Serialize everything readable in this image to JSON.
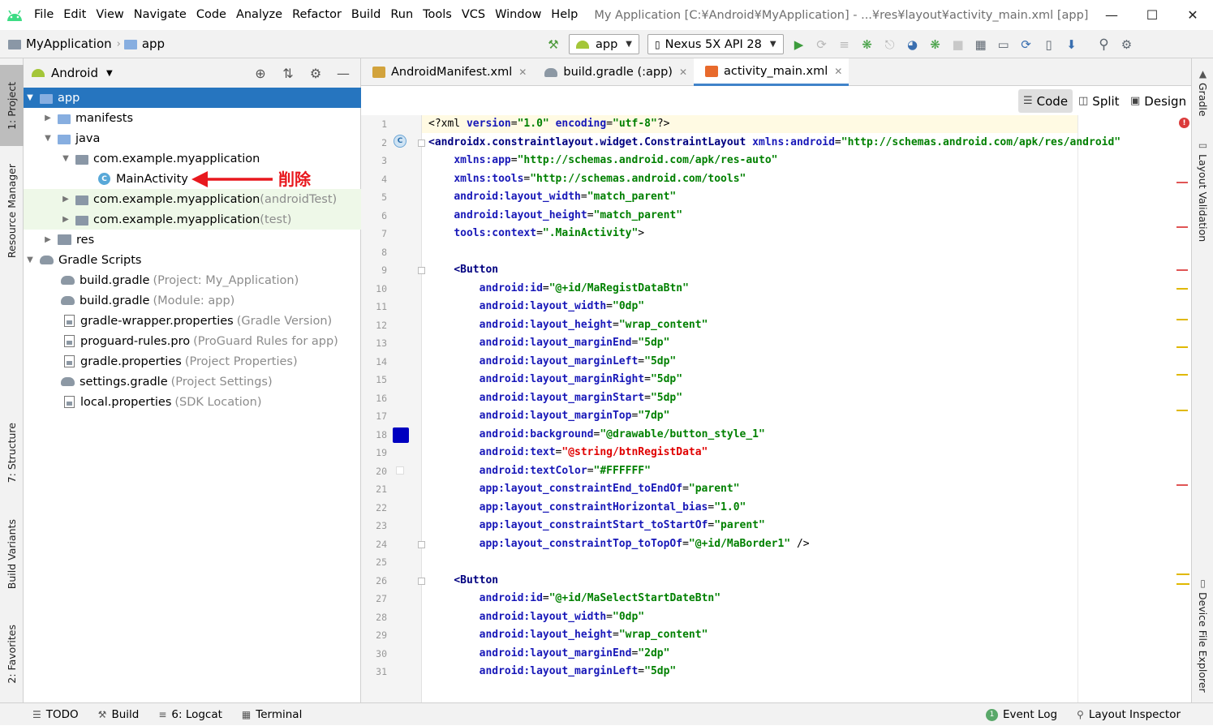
{
  "menubar": {
    "items": [
      "File",
      "Edit",
      "View",
      "Navigate",
      "Code",
      "Analyze",
      "Refactor",
      "Build",
      "Run",
      "Tools",
      "VCS",
      "Window",
      "Help"
    ],
    "window_title": "My Application [C:¥Android¥MyApplication] - ...¥res¥layout¥activity_main.xml [app]"
  },
  "navbar": {
    "project": "MyApplication",
    "module": "app",
    "run_config": "app",
    "device": "Nexus 5X API 28"
  },
  "left_tabs": [
    "1: Project",
    "Resource Manager",
    "7: Structure",
    "Build Variants",
    "2: Favorites"
  ],
  "right_tabs": [
    "Gradle",
    "Layout Validation",
    "Device File Explorer"
  ],
  "project_panel": {
    "view": "Android",
    "tree": [
      {
        "label": "app",
        "secondary": ""
      },
      {
        "label": "manifests",
        "secondary": ""
      },
      {
        "label": "java",
        "secondary": ""
      },
      {
        "label": "com.example.myapplication",
        "secondary": ""
      },
      {
        "label": "MainActivity",
        "secondary": ""
      },
      {
        "label": "com.example.myapplication",
        "secondary": "(androidTest)"
      },
      {
        "label": "com.example.myapplication",
        "secondary": "(test)"
      },
      {
        "label": "res",
        "secondary": ""
      },
      {
        "label": "Gradle Scripts",
        "secondary": ""
      },
      {
        "label": "build.gradle",
        "secondary": "(Project: My_Application)"
      },
      {
        "label": "build.gradle",
        "secondary": "(Module: app)"
      },
      {
        "label": "gradle-wrapper.properties",
        "secondary": "(Gradle Version)"
      },
      {
        "label": "proguard-rules.pro",
        "secondary": "(ProGuard Rules for app)"
      },
      {
        "label": "gradle.properties",
        "secondary": "(Project Properties)"
      },
      {
        "label": "settings.gradle",
        "secondary": "(Project Settings)"
      },
      {
        "label": "local.properties",
        "secondary": "(SDK Location)"
      }
    ]
  },
  "annotation": {
    "text": "削除",
    "color": "#e8181e"
  },
  "editor_tabs": [
    "AndroidManifest.xml",
    "build.gradle (:app)",
    "activity_main.xml"
  ],
  "editor_modes": [
    "Code",
    "Split",
    "Design"
  ],
  "code_lines": [
    "<?xml version=\"1.0\" encoding=\"utf-8\"?>",
    "<androidx.constraintlayout.widget.ConstraintLayout xmlns:android=\"http://schemas.android.com/apk/res/android\"",
    "    xmlns:app=\"http://schemas.android.com/apk/res-auto\"",
    "    xmlns:tools=\"http://schemas.android.com/tools\"",
    "    android:layout_width=\"match_parent\"",
    "    android:layout_height=\"match_parent\"",
    "    tools:context=\".MainActivity\">",
    "",
    "    <Button",
    "        android:id=\"@+id/MaRegistDataBtn\"",
    "        android:layout_width=\"0dp\"",
    "        android:layout_height=\"wrap_content\"",
    "        android:layout_marginEnd=\"5dp\"",
    "        android:layout_marginLeft=\"5dp\"",
    "        android:layout_marginRight=\"5dp\"",
    "        android:layout_marginStart=\"5dp\"",
    "        android:layout_marginTop=\"7dp\"",
    "        android:background=\"@drawable/button_style_1\"",
    "        android:text=\"@string/btnRegistData\"",
    "        android:textColor=\"#FFFFFF\"",
    "        app:layout_constraintEnd_toEndOf=\"parent\"",
    "        app:layout_constraintHorizontal_bias=\"1.0\"",
    "        app:layout_constraintStart_toStartOf=\"parent\"",
    "        app:layout_constraintTop_toTopOf=\"@+id/MaBorder1\" />",
    "",
    "    <Button",
    "        android:id=\"@+id/MaSelectStartDateBtn\"",
    "        android:layout_width=\"0dp\"",
    "        android:layout_height=\"wrap_content\"",
    "        android:layout_marginEnd=\"2dp\"",
    "        android:layout_marginLeft=\"5dp\""
  ],
  "statusbar": {
    "left": [
      "TODO",
      "Build",
      "6: Logcat",
      "Terminal"
    ],
    "right": [
      "Event Log",
      "Layout Inspector"
    ]
  },
  "colors": {
    "selection": "#2675bf",
    "annotation": "#e8181e",
    "brand_green": "#a4c639"
  }
}
